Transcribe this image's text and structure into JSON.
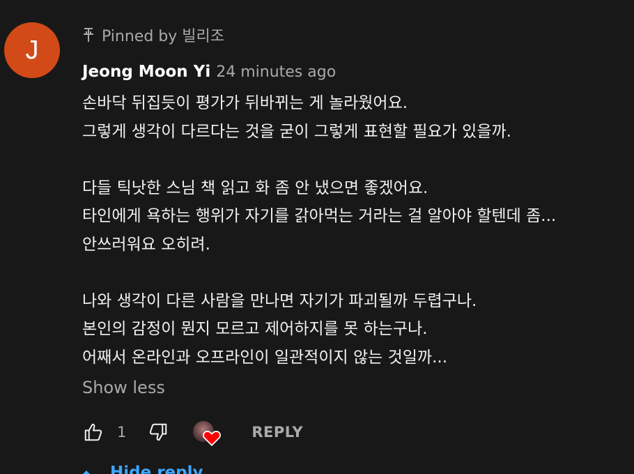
{
  "avatar_initial": "J",
  "pinned_text": "Pinned by 빌리조",
  "author": "Jeong Moon Yi",
  "timestamp": "24 minutes ago",
  "comment_lines": [
    "손바닥 뒤집듯이 평가가 뒤바뀌는 게 놀라웠어요.",
    "그렇게 생각이 다르다는 것을 굳이 그렇게 표현할 필요가 있을까.",
    "",
    "다들 틱낫한 스님 책 읽고 화 좀 안 냈으면 좋겠어요.",
    "타인에게 욕하는 행위가 자기를 갉아먹는 거라는 걸 알아야 할텐데 좀...",
    "안쓰러워요 오히려.",
    "",
    "나와 생각이 다른 사람을 만나면 자기가 파괴될까 두렵구나.",
    "본인의 감정이 뭔지 모르고 제어하지를 못 하는구나.",
    "어째서 온라인과 오프라인이 일관적이지 않는 것일까..."
  ],
  "show_less_label": "Show less",
  "like_count": "1",
  "reply_label": "REPLY",
  "hide_reply_label": "Hide reply",
  "colors": {
    "background": "#181818",
    "avatar": "#d14a17",
    "heart": "#ff0000",
    "link": "#3ea6ff",
    "secondary_text": "#aaaaaa"
  },
  "icons": [
    "pin-icon",
    "thumbs-up-icon",
    "thumbs-down-icon",
    "heart-icon",
    "caret-up-icon"
  ]
}
